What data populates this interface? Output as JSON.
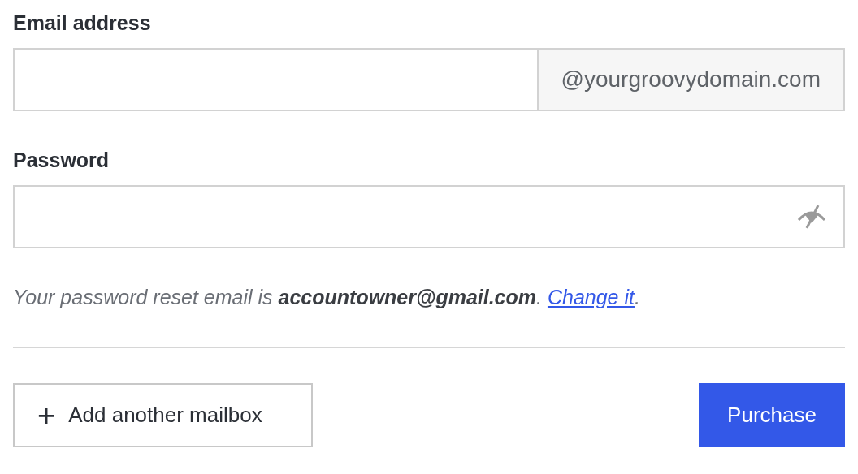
{
  "email": {
    "label": "Email address",
    "suffix": "@yourgroovydomain.com"
  },
  "password": {
    "label": "Password"
  },
  "note": {
    "text": "Your password reset email is **accountowner@gmail.com**. ",
    "link": "Change it",
    "after": "."
  },
  "buttons": {
    "add": {
      "icon": "+",
      "label": "Add another mailbox"
    },
    "purchase": "Purchase"
  }
}
